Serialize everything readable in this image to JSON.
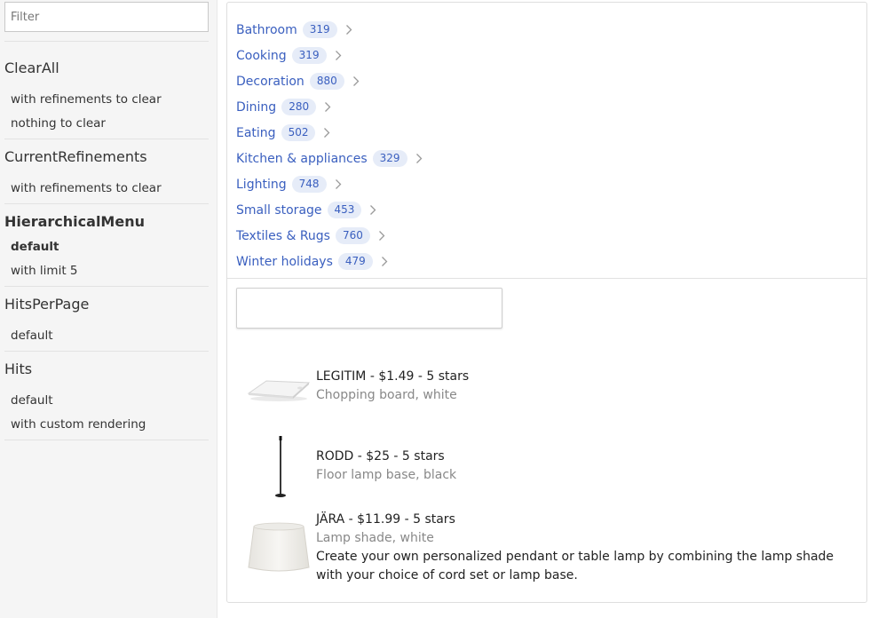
{
  "sidebar": {
    "filter_placeholder": "Filter",
    "stories": [
      {
        "title": "ClearAll",
        "items": [
          "with refinements to clear",
          "nothing to clear"
        ]
      },
      {
        "title": "CurrentRefinements",
        "items": [
          "with refinements to clear"
        ]
      },
      {
        "title": "HierarchicalMenu",
        "items": [
          "default",
          "with limit 5"
        ]
      },
      {
        "title": "HitsPerPage",
        "items": [
          "default"
        ]
      },
      {
        "title": "Hits",
        "items": [
          "default",
          "with custom rendering"
        ]
      }
    ]
  },
  "menu": {
    "categories": [
      {
        "label": "Bathroom",
        "count": "319"
      },
      {
        "label": "Cooking",
        "count": "319"
      },
      {
        "label": "Decoration",
        "count": "880"
      },
      {
        "label": "Dining",
        "count": "280"
      },
      {
        "label": "Eating",
        "count": "502"
      },
      {
        "label": "Kitchen & appliances",
        "count": "329"
      },
      {
        "label": "Lighting",
        "count": "748"
      },
      {
        "label": "Small storage",
        "count": "453"
      },
      {
        "label": "Textiles & Rugs",
        "count": "760"
      },
      {
        "label": "Winter holidays",
        "count": "479"
      }
    ]
  },
  "search": {
    "value": "",
    "placeholder": ""
  },
  "hits": [
    {
      "title": "LEGITIM - $1.49 - 5 stars",
      "subtitle": "Chopping board, white",
      "description": "",
      "image_icon": "chopping-board-image"
    },
    {
      "title": "RODD - $25 - 5 stars",
      "subtitle": "Floor lamp base, black",
      "description": "",
      "image_icon": "floor-lamp-image"
    },
    {
      "title": "JÄRA - $11.99 - 5 stars",
      "subtitle": "Lamp shade, white",
      "description": "Create your own personalized pendant or table lamp by combining the lamp shade with your choice of cord set or lamp base.",
      "image_icon": "lamp-shade-image"
    }
  ],
  "colors": {
    "link": "#3a5fbf",
    "badge_bg": "#e6ecf8",
    "sidebar_bg": "#f5f5f5"
  }
}
